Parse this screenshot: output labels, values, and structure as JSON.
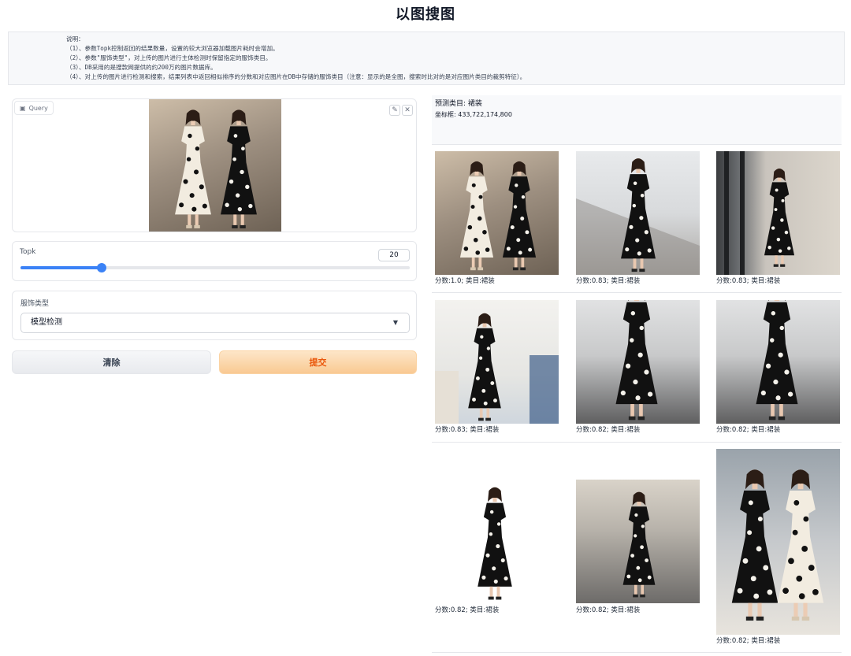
{
  "page": {
    "title": "以图搜图"
  },
  "description": {
    "lines": [
      "说明：",
      "（1）、参数Topk控制返回的结果数量，设置的较大浏览器加载图片耗时会增加。",
      "（2）、参数\"服饰类型\"，对上传的图片进行主体检测时保留指定的服饰类目。",
      "（3）、DB采用的是搜款网提供的约200万的图片数据库。",
      "（4）、对上传的图片进行检测和搜索，结果列表中返回相似排序的分数和对应图片在DB中存储的服饰类目（注意：显示的是全图，搜索时比对的是对应图片类目的裁剪特征）。"
    ]
  },
  "query": {
    "label": "Query",
    "edit_icon": "pencil-icon",
    "close_icon": "close-icon"
  },
  "topk": {
    "label": "Topk",
    "value": 20,
    "slider_fraction": 0.208,
    "accent": "#3b82f6"
  },
  "clothing_type": {
    "label": "服饰类型",
    "selected": "模型检测"
  },
  "buttons": {
    "clear": "清除",
    "submit": "提交"
  },
  "prediction": {
    "category": "预测类目: 裙装",
    "bbox": "坐标框: 433,722,174,800"
  },
  "results": [
    {
      "caption": "分数:1.0; 类目:裙装"
    },
    {
      "caption": "分数:0.83; 类目:裙装"
    },
    {
      "caption": "分数:0.83; 类目:裙装"
    },
    {
      "caption": "分数:0.83; 类目:裙装"
    },
    {
      "caption": "分数:0.82; 类目:裙装"
    },
    {
      "caption": "分数:0.82; 类目:裙装"
    },
    {
      "caption": "分数:0.82; 类目:裙装"
    },
    {
      "caption": "分数:0.82; 类目:裙装"
    },
    {
      "caption": "分数:0.82; 类目:裙装"
    }
  ]
}
